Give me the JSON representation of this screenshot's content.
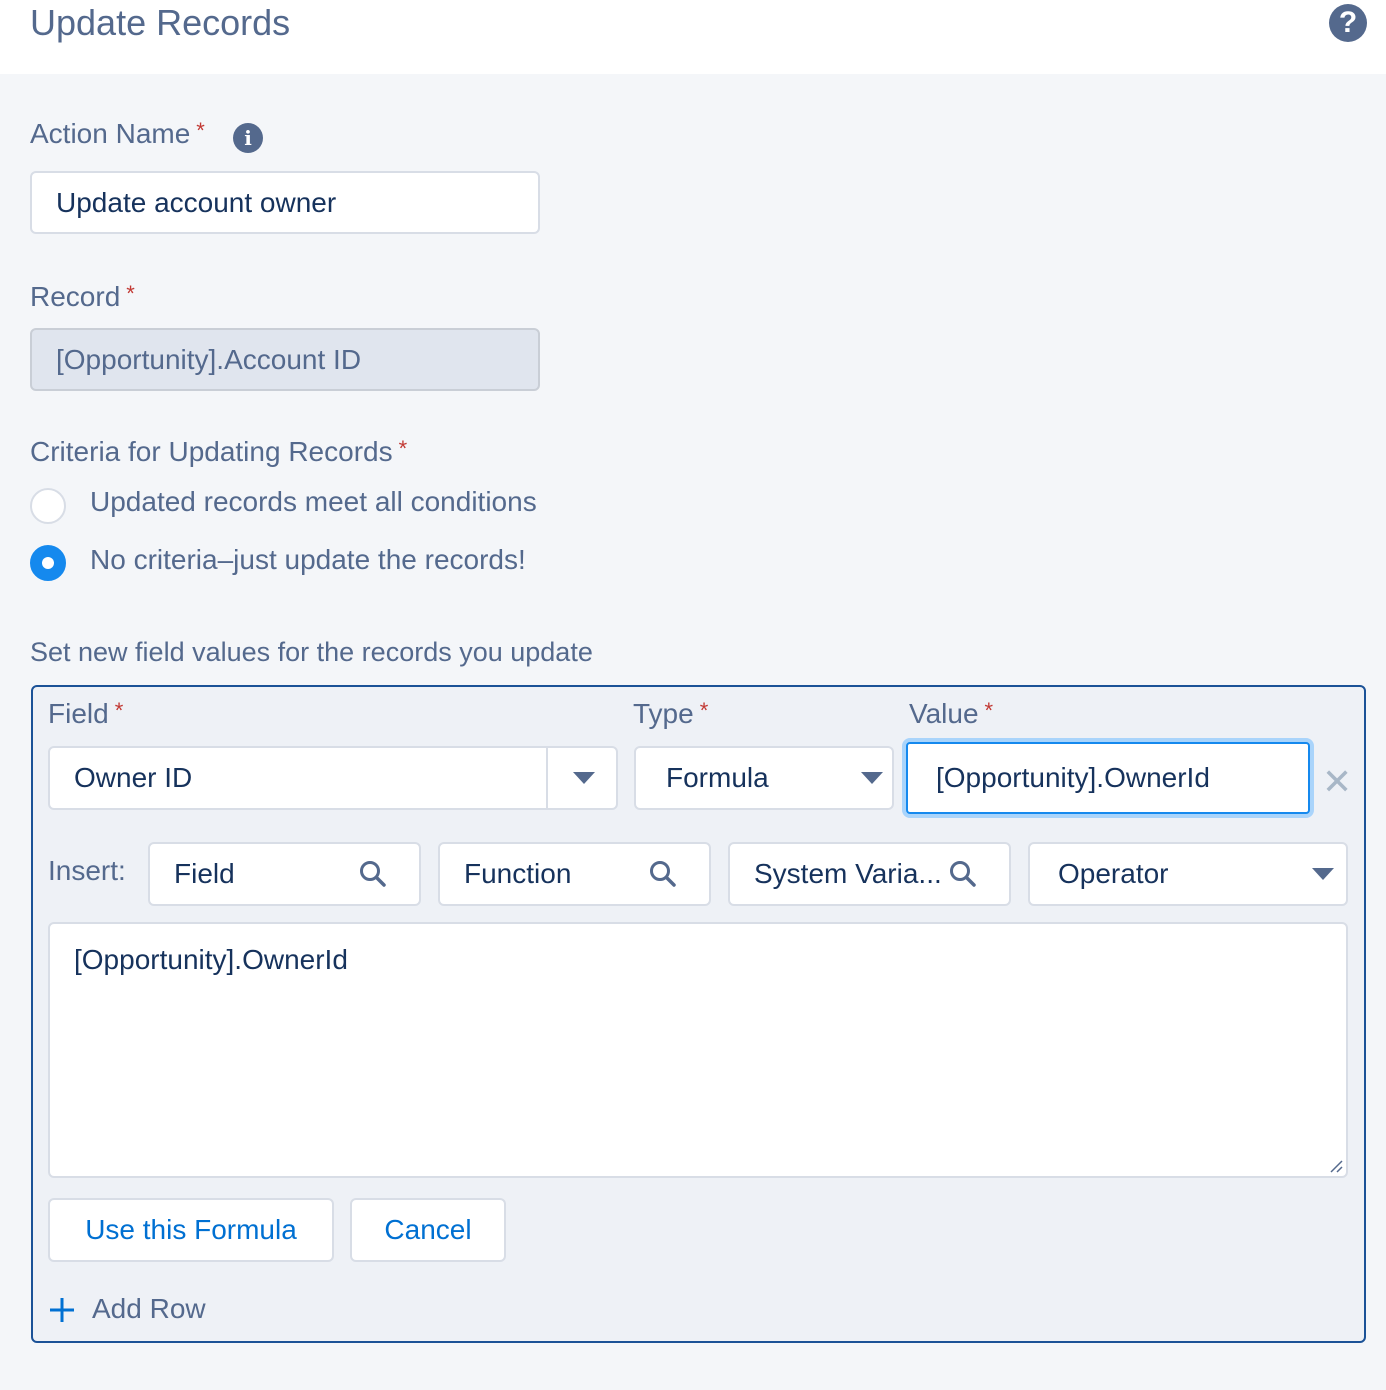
{
  "header": {
    "title": "Update Records",
    "help_glyph": "?",
    "help_icon": "question-circle-icon"
  },
  "form": {
    "action_name": {
      "label": "Action Name",
      "required": "*",
      "info_glyph": "i",
      "value": "Update account owner"
    },
    "record": {
      "label": "Record",
      "required": "*",
      "value": "[Opportunity].Account ID"
    },
    "criteria": {
      "label": "Criteria for Updating Records",
      "required": "*",
      "options": [
        {
          "label": "Updated records meet all conditions",
          "selected": false
        },
        {
          "label": "No criteria–just update the records!",
          "selected": true
        }
      ]
    }
  },
  "field_values": {
    "heading": "Set new field values for the records you update",
    "columns": {
      "field": "Field",
      "type": "Type",
      "value": "Value",
      "required": "*"
    },
    "row": {
      "field": "Owner ID",
      "type": "Formula",
      "value": "[Opportunity].OwnerId",
      "remove_glyph": "✕"
    },
    "insert": {
      "label": "Insert:",
      "field": "Field",
      "function": "Function",
      "system_variable": "System Varia...",
      "operator": "Operator"
    },
    "formula_text": "[Opportunity].OwnerId",
    "use_formula_button": "Use this Formula",
    "cancel_button": "Cancel",
    "add_row": {
      "glyph": "+",
      "label": "Add Row"
    }
  },
  "colors": {
    "accent": "#1589ee",
    "link": "#0070d2",
    "required": "#c23934",
    "panel_border": "#1b5297"
  }
}
